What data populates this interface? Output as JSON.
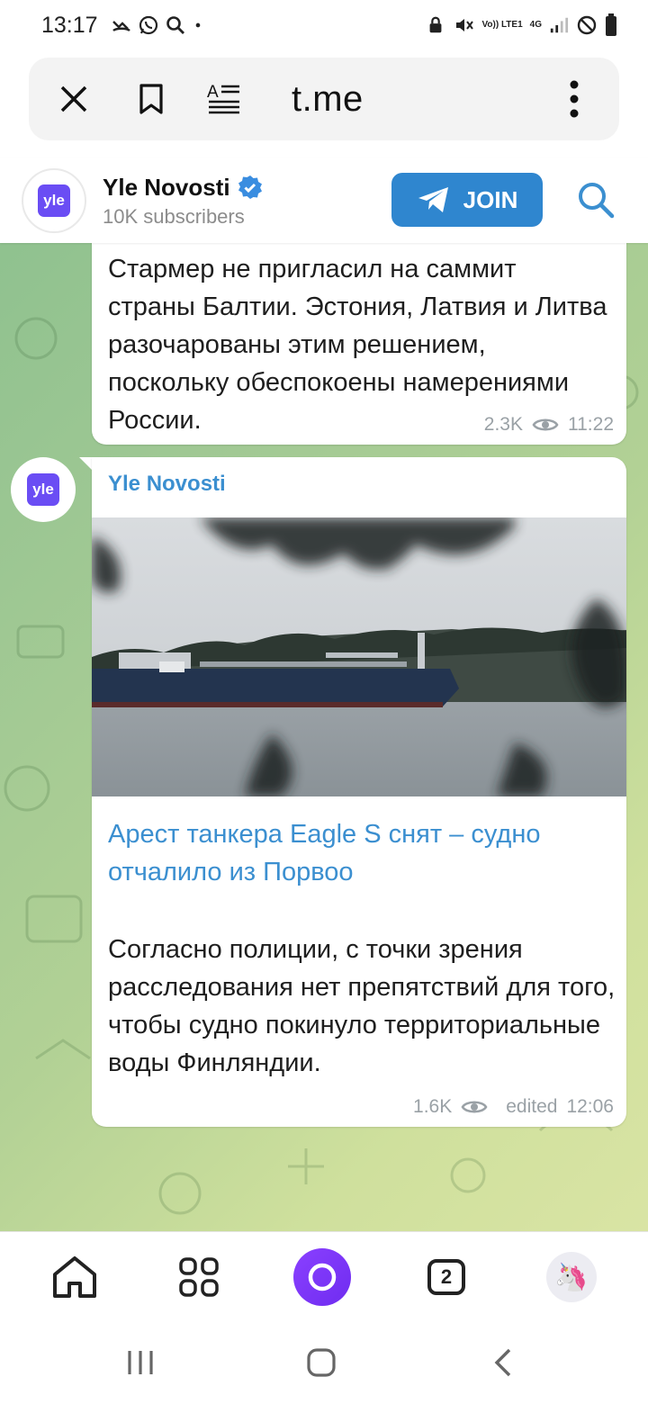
{
  "status_bar": {
    "time": "13:17",
    "network": "4G",
    "volte": "Vo)) LTE1"
  },
  "browser": {
    "url": "t.me",
    "close_icon": "close-icon",
    "bookmark_icon": "bookmark-icon",
    "reader_icon": "reader-mode-icon",
    "menu_icon": "more-vertical-icon"
  },
  "channel": {
    "avatar_text": "yle",
    "title": "Yle Novosti",
    "verified": true,
    "subscribers": "10K subscribers",
    "join_label": "JOIN"
  },
  "messages": [
    {
      "text": "Стармер не пригласил на саммит страны Балтии. Эстония, Латвия и Литва разочарованы этим решением, поскольку обеспокоены намерениями России.",
      "views": "2.3K",
      "time": "11:22"
    },
    {
      "sender": "Yle Novosti",
      "link_title": "Арест танкера Eagle S снят – судно отчалило из Порвоо",
      "text": "Согласно полиции, с точки зрения расследования нет препятствий для того, чтобы судно покинуло территориальные воды Финляндии.",
      "views": "1.6K",
      "edited": "edited",
      "time": "12:06"
    }
  ],
  "bottom_nav": {
    "tabs_count": "2",
    "profile_emoji": "🦄"
  },
  "colors": {
    "accent": "#2f86cf",
    "link": "#3b8fd0",
    "alice": "#7a35f5"
  }
}
